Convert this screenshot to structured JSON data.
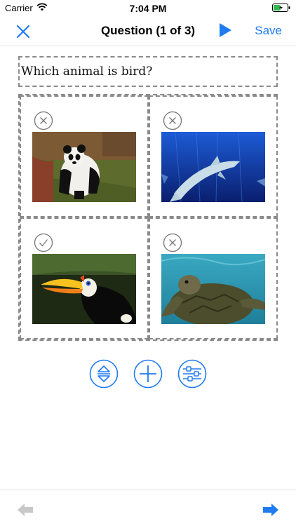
{
  "status_bar": {
    "carrier": "Carrier",
    "time": "7:04 PM",
    "icons": [
      "wifi-icon",
      "battery-icon"
    ]
  },
  "nav": {
    "title": "Question (1 of 3)",
    "save_label": "Save",
    "icons": [
      "close-icon",
      "play-icon"
    ]
  },
  "question": {
    "text": "Which animal is bird?"
  },
  "answers": [
    {
      "image": "panda",
      "marked": "incorrect",
      "icon": "x-circle-icon"
    },
    {
      "image": "shark",
      "marked": "incorrect",
      "icon": "x-circle-icon"
    },
    {
      "image": "toucan",
      "marked": "correct",
      "icon": "check-circle-icon"
    },
    {
      "image": "sea-turtle",
      "marked": "incorrect",
      "icon": "x-circle-icon"
    }
  ],
  "toolbar": {
    "icons": [
      "reorder-icon",
      "add-icon",
      "sliders-icon"
    ]
  },
  "bottom": {
    "icons": [
      "arrow-left-icon",
      "arrow-right-icon"
    ]
  },
  "colors": {
    "accent": "#1e7bf0",
    "dash_border": "#8a8a8a",
    "disabled": "#c8c8c8"
  }
}
